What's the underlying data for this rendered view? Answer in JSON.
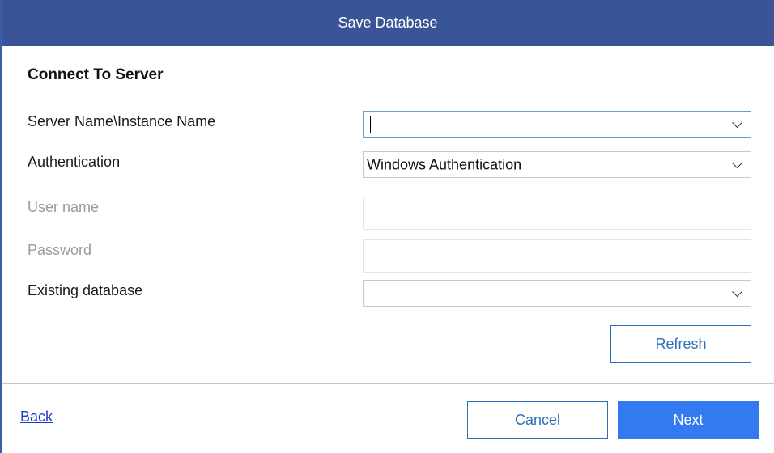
{
  "window": {
    "title": "Save Database"
  },
  "section": {
    "title": "Connect To Server"
  },
  "form": {
    "server_label": "Server Name\\Instance Name",
    "server_value": "",
    "auth_label": "Authentication",
    "auth_value": "Windows Authentication",
    "username_label": "User name",
    "password_label": "Password",
    "existing_db_label": "Existing database",
    "existing_db_value": ""
  },
  "buttons": {
    "refresh": "Refresh",
    "back": "Back",
    "cancel": "Cancel",
    "next": "Next"
  },
  "icons": {
    "dropdown": "chevron-down-icon"
  },
  "colors": {
    "titlebar": "#3a5597",
    "primary": "#3379f0",
    "outline": "#2f6fb5",
    "link": "#1a3fc9"
  }
}
